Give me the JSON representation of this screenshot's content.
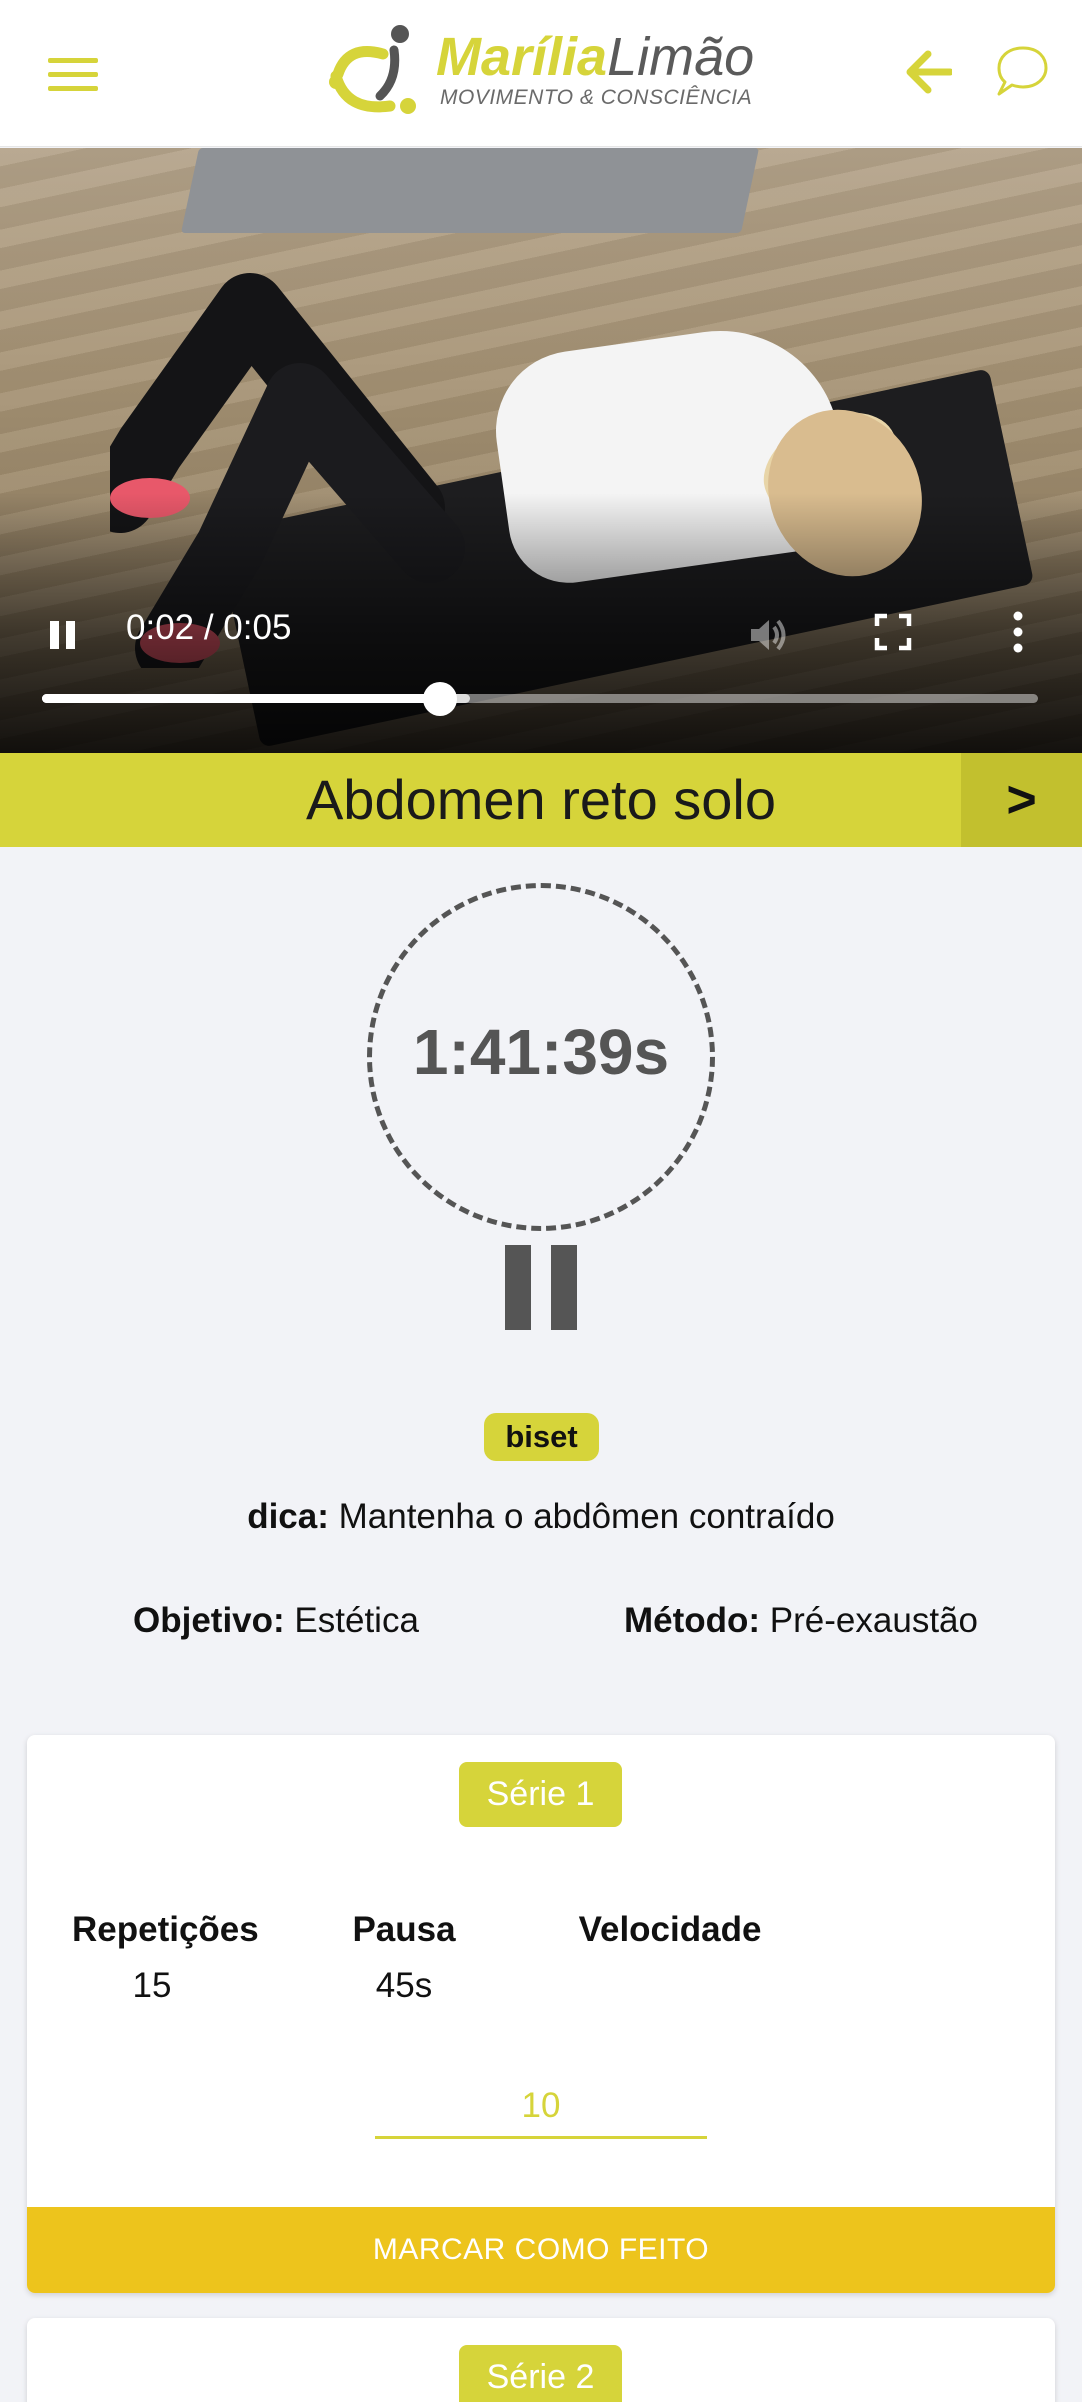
{
  "colors": {
    "accent": "#d6d43a",
    "button": "#edc41c",
    "timer": "#555555",
    "background": "#f2f3f7"
  },
  "header": {
    "logo_part1": "Marília",
    "logo_part2": "Limão",
    "logo_tagline": "MOVIMENTO & CONSCIÊNCIA",
    "menu_icon": "hamburger-menu-icon",
    "back_icon": "arrow-left-icon",
    "chat_icon": "chat-bubble-icon"
  },
  "video": {
    "time": "0:02 / 0:05",
    "progress": 0.4,
    "buffered": 0.43,
    "controls": [
      "pause-icon",
      "volume-icon",
      "fullscreen-icon",
      "more-vert-icon"
    ]
  },
  "exercise": {
    "title": "Abdomen reto solo",
    "next_label": ">"
  },
  "timer": {
    "value": "1:41:39s",
    "pause_icon": "pause-icon"
  },
  "info": {
    "badge": "biset",
    "tip_label": "dica:",
    "tip_text": " Mantenha o abdômen contraído",
    "goal_label": "Objetivo:",
    "goal_value": " Estética",
    "method_label": "Método:",
    "method_value": " Pré-exaustão"
  },
  "series": [
    {
      "label": "Série 1",
      "headers": [
        "Repetições",
        "Pausa",
        "Velocidade"
      ],
      "values": [
        "15",
        "45s",
        ""
      ],
      "input_value": "10",
      "button": "MARCAR COMO FEITO"
    },
    {
      "label": "Série 2"
    }
  ]
}
